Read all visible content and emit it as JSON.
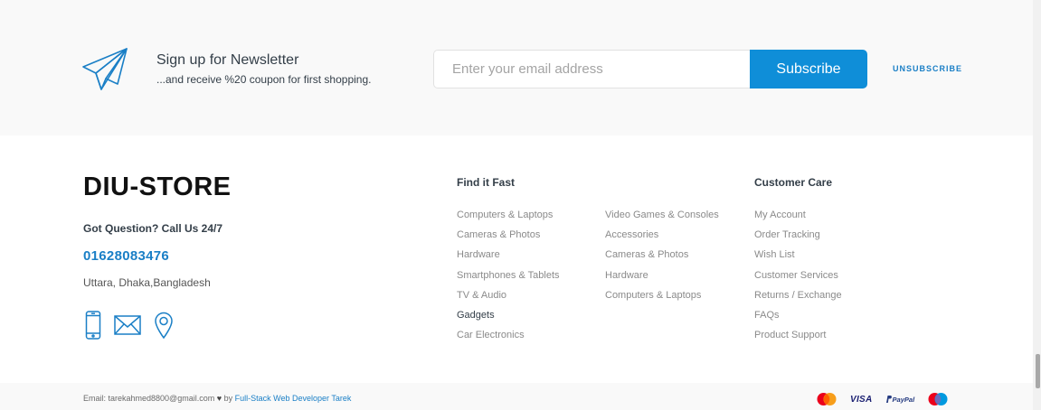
{
  "newsletter": {
    "title": "Sign up for Newsletter",
    "subtitle": "...and receive %20 coupon for first shopping.",
    "email_placeholder": "Enter your email address",
    "subscribe_label": "Subscribe",
    "unsubscribe_label": "UNSUBSCRIBE",
    "icon": "paper-plane-icon"
  },
  "brand": {
    "name": "DIU-STORE",
    "question": "Got Question? Call Us 24/7",
    "phone": "01628083476",
    "address": "Uttara, Dhaka,Bangladesh",
    "icons": [
      "mobile-phone-icon",
      "envelope-icon",
      "location-pin-icon"
    ]
  },
  "find_it_fast": {
    "title": "Find it Fast",
    "col1": [
      "Computers & Laptops",
      "Cameras & Photos",
      "Hardware",
      "Smartphones & Tablets",
      "TV & Audio",
      "Gadgets",
      "Car Electronics"
    ],
    "col2": [
      "Video Games & Consoles",
      "Accessories",
      "Cameras & Photos",
      "Hardware",
      "Computers & Laptops"
    ]
  },
  "customer_care": {
    "title": "Customer Care",
    "items": [
      "My Account",
      "Order Tracking",
      "Wish List",
      "Customer Services",
      "Returns / Exchange",
      "FAQs",
      "Product Support"
    ]
  },
  "footer": {
    "email_text": "Email: tarekahmed8800@gmail.com",
    "heart": "♥",
    "by_text": "by",
    "developer": "Full-Stack Web Developer Tarek",
    "payments": {
      "visa": "VISA",
      "paypal": "PayPal",
      "icons": [
        "mastercard-icon",
        "visa-icon",
        "paypal-icon",
        "maestro-icon"
      ]
    }
  },
  "colors": {
    "accent": "#0f8ed8",
    "link": "#1a7fc6",
    "band_bg": "#f9f9f9",
    "text_dark": "#333e48",
    "text_muted": "#8a8a8a"
  }
}
